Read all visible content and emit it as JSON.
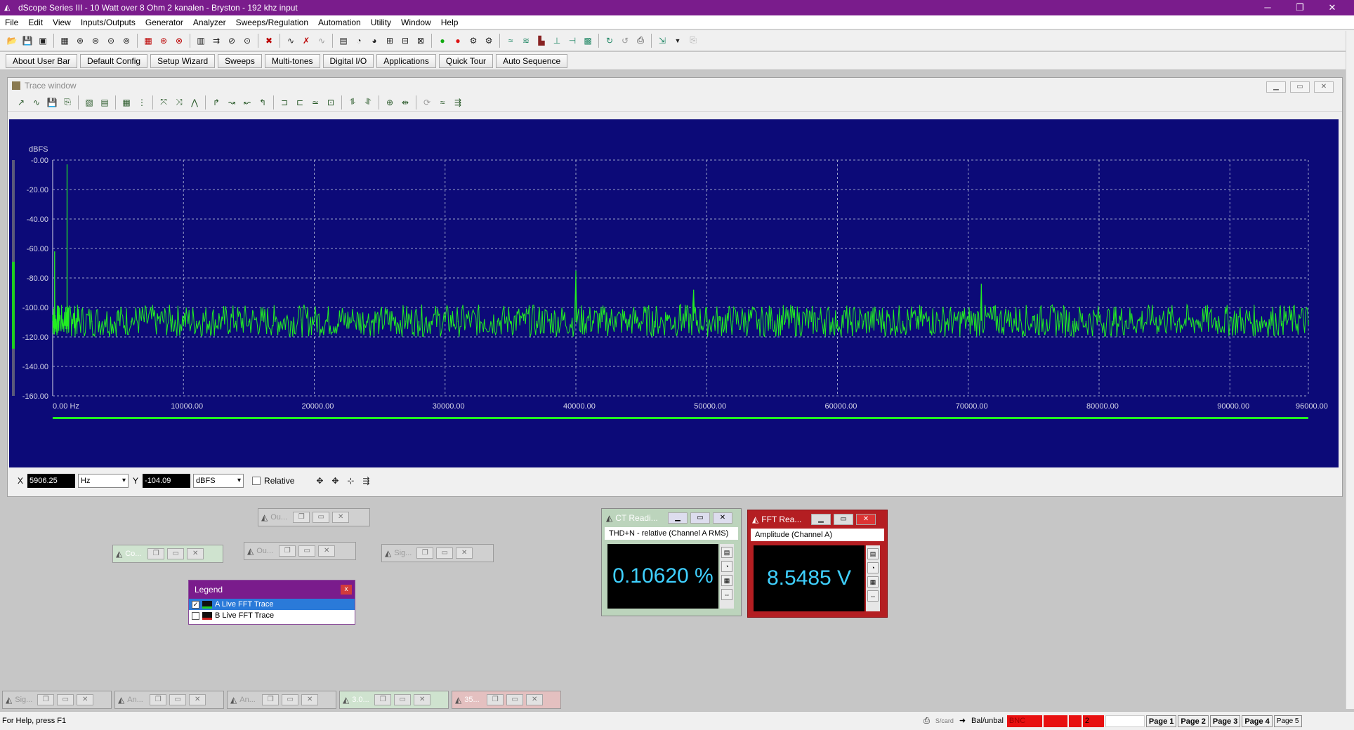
{
  "window": {
    "title": "dScope Series III - 10 Watt over 8 Ohm 2 kanalen - Bryston - 192 khz input",
    "minimize": "─",
    "restore": "❐",
    "close": "✕"
  },
  "menu": [
    "File",
    "Edit",
    "View",
    "Inputs/Outputs",
    "Generator",
    "Analyzer",
    "Sweeps/Regulation",
    "Automation",
    "Utility",
    "Window",
    "Help"
  ],
  "user_bar": [
    "About User Bar",
    "Default Config",
    "Setup Wizard",
    "Sweeps",
    "Multi-tones",
    "Digital I/O",
    "Applications",
    "Quick Tour",
    "Auto Sequence"
  ],
  "trace_window": {
    "title": "Trace window",
    "x_label": "X",
    "x_value": "5906.25",
    "x_unit": "Hz",
    "y_label": "Y",
    "y_value": "-104.09",
    "y_unit": "dBFS",
    "relative_label": "Relative"
  },
  "chart_data": {
    "type": "line",
    "ylabel": "dBFS",
    "xlim": [
      0,
      96000
    ],
    "ylim": [
      -160,
      0
    ],
    "x_ticks": [
      "0.00 Hz",
      "10000.00",
      "20000.00",
      "30000.00",
      "40000.00",
      "50000.00",
      "60000.00",
      "70000.00",
      "80000.00",
      "90000.00",
      "96000.00"
    ],
    "y_ticks": [
      "-0.00",
      "-20.00",
      "-40.00",
      "-60.00",
      "-80.00",
      "-100.00",
      "-120.00",
      "-140.00",
      "-160.00"
    ],
    "grid": true,
    "series": [
      {
        "color": "#22ee22",
        "x": [
          0,
          150,
          500,
          1000,
          1100,
          1200,
          1500,
          2000,
          3000,
          4000,
          5000,
          6000,
          7000,
          8000,
          9000,
          10000,
          11000,
          12000,
          13000,
          14000,
          15000,
          16000,
          17000,
          18000,
          19000,
          20000,
          21000,
          22000,
          23000,
          24000,
          25000,
          26000,
          27000,
          28000,
          29000,
          30000,
          31000,
          32000,
          33000,
          34000,
          35000,
          36000,
          37000,
          38000,
          39000,
          40000,
          41000,
          42000,
          43000,
          44000,
          45000,
          46000,
          47000,
          48000,
          49000,
          50000,
          51000,
          52000,
          53000,
          54000,
          55000,
          56000,
          57000,
          58000,
          59000,
          60000,
          61000,
          62000,
          63000,
          64000,
          65000,
          66000,
          67000,
          68000,
          69000,
          70000,
          71000,
          72000,
          73000,
          74000,
          75000,
          76000,
          77000,
          78000,
          79000,
          80000,
          81000,
          82000,
          83000,
          84000,
          85000,
          86000,
          87000,
          88000,
          89000,
          90000,
          91000,
          92000,
          93000,
          94000,
          95000,
          96000
        ],
        "y": [
          -105,
          -62,
          -100,
          -100,
          -3,
          -100,
          -108,
          -106,
          -110,
          -108,
          -102,
          -112,
          -110,
          -104,
          -108,
          -112,
          -110,
          -109,
          -108,
          -110,
          -111,
          -108,
          -110,
          -109,
          -108,
          -108,
          -110,
          -110,
          -109,
          -111,
          -108,
          -108,
          -110,
          -111,
          -112,
          -110,
          -110,
          -110,
          -108,
          -110,
          -111,
          -106,
          -110,
          -108,
          -104,
          -75,
          -108,
          -110,
          -106,
          -108,
          -110,
          -112,
          -105,
          -98,
          -88,
          -100,
          -106,
          -110,
          -112,
          -108,
          -108,
          -110,
          -112,
          -110,
          -108,
          -110,
          -112,
          -110,
          -108,
          -108,
          -110,
          -107,
          -106,
          -108,
          -108,
          -110,
          -84,
          -100,
          -108,
          -108,
          -106,
          -108,
          -110,
          -110,
          -110,
          -108,
          -110,
          -110,
          -108,
          -108,
          -109,
          -110,
          -109,
          -110,
          -110,
          -110,
          -109,
          -110,
          -108,
          -110,
          -110,
          -112
        ]
      }
    ]
  },
  "mini_windows": [
    "Ou...",
    "Co...",
    "Ou...",
    "Sig..."
  ],
  "legend": {
    "title": "Legend",
    "close": "x",
    "rows": [
      {
        "label": "A  Live FFT Trace",
        "checked": "✓"
      },
      {
        "label": "B  Live FFT Trace",
        "checked": ""
      }
    ]
  },
  "reader_thd": {
    "title": "CT Readi...",
    "subtitle": "THD+N - relative (Channel A RMS)",
    "value": "0.10620 %"
  },
  "reader_fft": {
    "title": "FFT Rea...",
    "subtitle": "Amplitude (Channel A)",
    "value": "8.5485 V"
  },
  "bottom_windows": [
    "Sig...",
    "An...",
    "An...",
    "3.0...",
    "35..."
  ],
  "status": {
    "help": "For Help, press F1",
    "sicard": "S/card",
    "balunbal": "Bal/unbal",
    "bnc": "BNC",
    "pages": [
      "Page 1",
      "Page 2",
      "Page 3",
      "Page 4",
      "Page 5"
    ],
    "num": "2"
  }
}
